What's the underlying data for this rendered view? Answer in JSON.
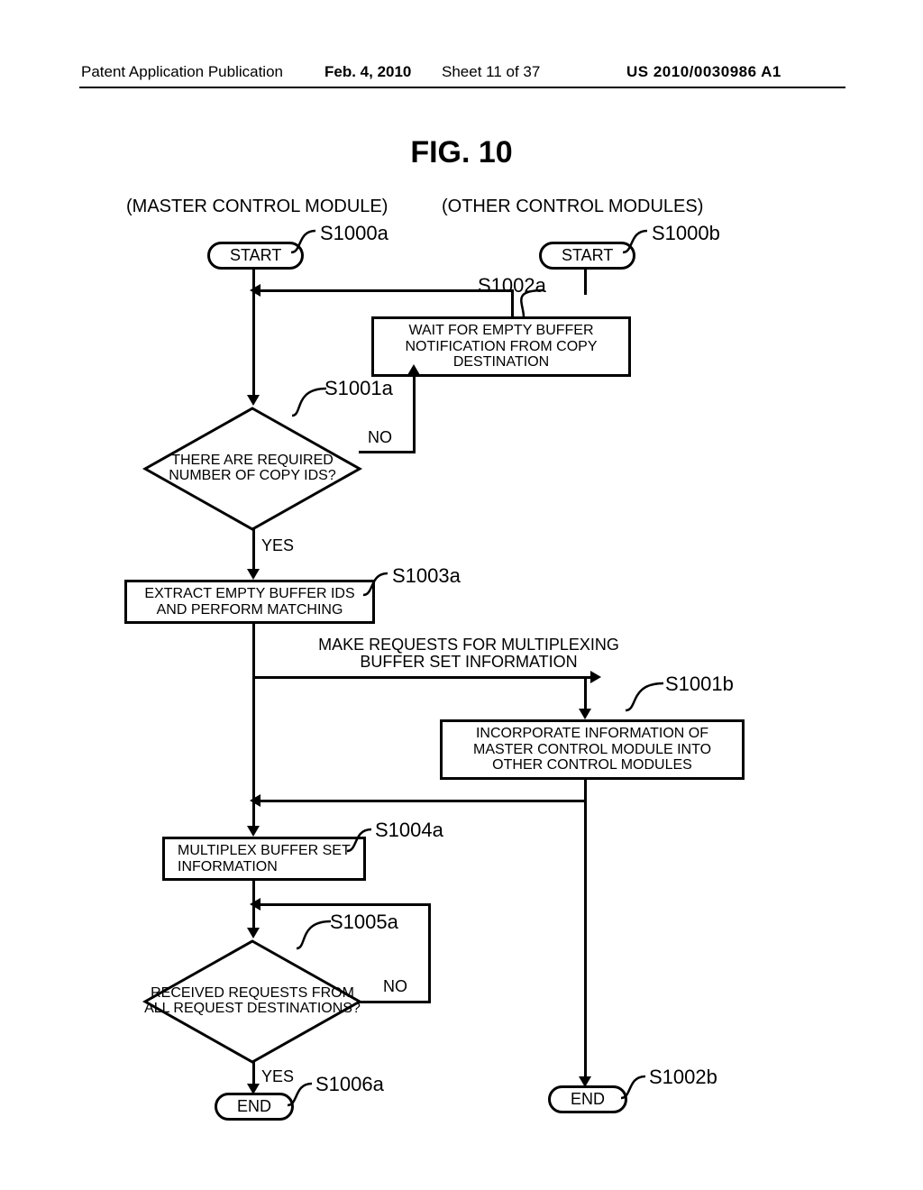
{
  "header": {
    "publication": "Patent Application Publication",
    "date": "Feb. 4, 2010",
    "sheet": "Sheet 11 of 37",
    "pubno": "US 2010/0030986 A1"
  },
  "figure_title": "FIG. 10",
  "columns": {
    "left": "(MASTER CONTROL MODULE)",
    "right": "(OTHER CONTROL MODULES)"
  },
  "blocks": {
    "start_a": "START",
    "start_b": "START",
    "wait": "WAIT FOR EMPTY BUFFER NOTIFICATION FROM COPY DESTINATION",
    "d1001a": "THERE ARE REQUIRED NUMBER OF COPY IDS?",
    "d1001a_yes": "YES",
    "d1001a_no": "NO",
    "extract": "EXTRACT EMPTY BUFFER IDS AND PERFORM MATCHING",
    "mpx_text": "MAKE REQUESTS FOR MULTIPLEXING BUFFER SET INFORMATION",
    "incorp": "INCORPORATE INFORMATION OF MASTER CONTROL MODULE INTO OTHER CONTROL MODULES",
    "mpx_set": "MULTIPLEX BUFFER SET INFORMATION",
    "d1005a": "RECEIVED REQUESTS FROM ALL REQUEST DESTINATIONS?",
    "d1005a_yes": "YES",
    "d1005a_no": "NO",
    "end_a": "END",
    "end_b": "END"
  },
  "step_labels": {
    "s1000a": "S1000a",
    "s1000b": "S1000b",
    "s1001a": "S1001a",
    "s1002a": "S1002a",
    "s1003a": "S1003a",
    "s1004a": "S1004a",
    "s1005a": "S1005a",
    "s1006a": "S1006a",
    "s1001b": "S1001b",
    "s1002b": "S1002b"
  }
}
